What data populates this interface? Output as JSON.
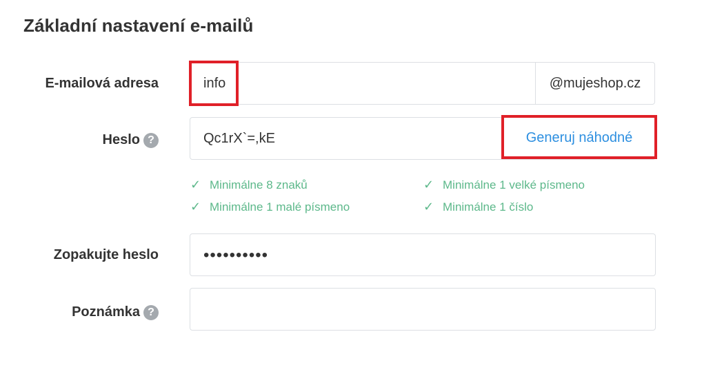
{
  "section": {
    "title": "Základní nastavení e-mailů"
  },
  "email": {
    "label": "E-mailová adresa",
    "value": "info",
    "domain": "@mujeshop.cz"
  },
  "password": {
    "label": "Heslo",
    "value": "Qc1rX`=,kE",
    "generate_label": "Generuj náhodné",
    "rules": [
      {
        "text": "Minimálne 8 znaků",
        "satisfied": true
      },
      {
        "text": "Minimálne 1 velké písmeno",
        "satisfied": true
      },
      {
        "text": "Minimálne 1 malé písmeno",
        "satisfied": true
      },
      {
        "text": "Minimálne 1 číslo",
        "satisfied": true
      }
    ]
  },
  "repeat_password": {
    "label": "Zopakujte heslo",
    "masked_value": "••••••••••"
  },
  "note": {
    "label": "Poznámka",
    "value": ""
  },
  "icons": {
    "help": "question-circle-icon",
    "check": "checkmark-icon"
  },
  "colors": {
    "text": "#333333",
    "link": "#2d8fe0",
    "success": "#5cb88a",
    "highlight": "#e02028",
    "border": "#dcdfe3",
    "help_icon": "#a4a9ae"
  }
}
